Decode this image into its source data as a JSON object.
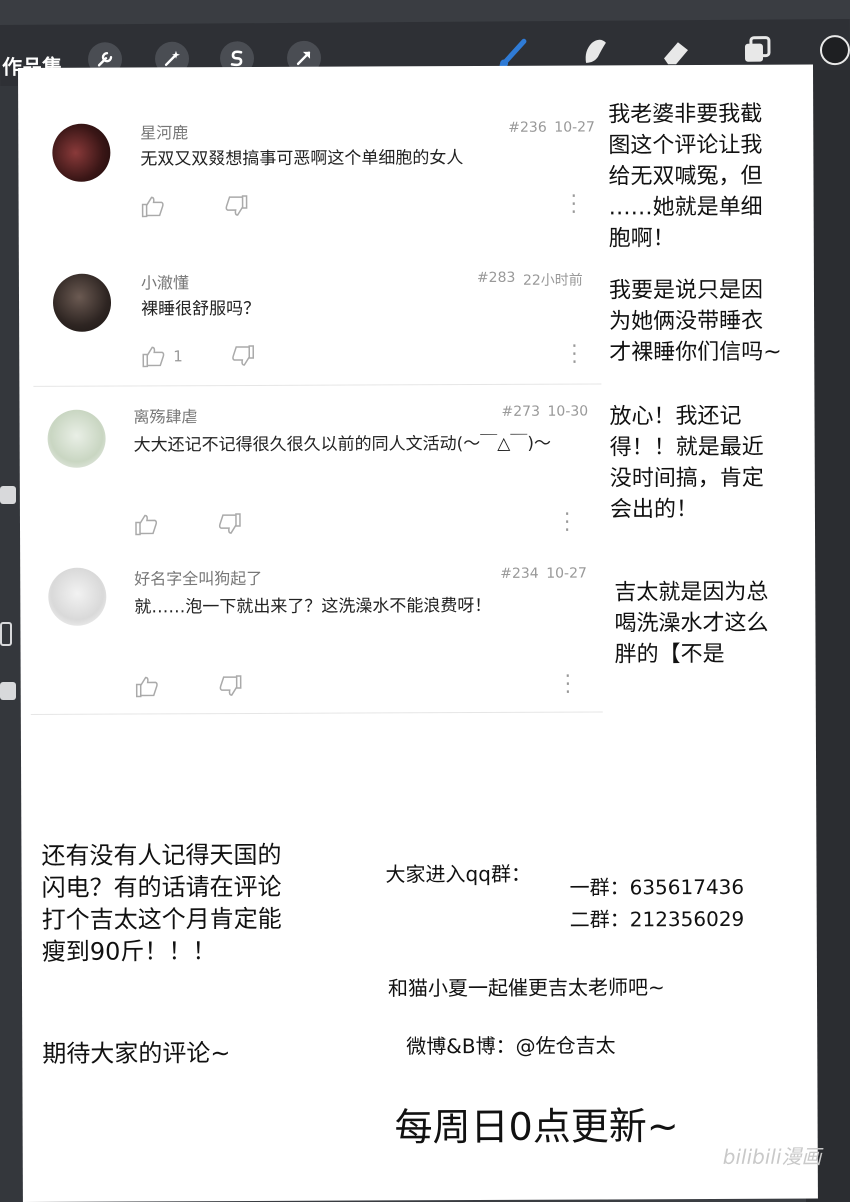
{
  "toolbar": {
    "title": "作品集",
    "tools": [
      "wrench-icon",
      "magic-wand-icon",
      "selection-s-icon",
      "transform-arrow-icon"
    ],
    "right_tools": [
      "brush-icon",
      "smudge-icon",
      "eraser-icon",
      "layers-icon",
      "color-circle-icon"
    ],
    "accent": "#2f7bd6"
  },
  "comments": [
    {
      "user": "星河鹿",
      "floor": "#236",
      "time": "10-27",
      "text": "无双又双叕想搞事可恶啊这个单细胞的女人",
      "likes": ""
    },
    {
      "user": "小澈懂",
      "floor": "#283",
      "time": "22小时前",
      "text": "裸睡很舒服吗？",
      "likes": "1"
    },
    {
      "user": "离殇肆虐",
      "floor": "#273",
      "time": "10-30",
      "text": "大大还记不记得很久很久以前的同人文活动(～￣△￣)～",
      "likes": ""
    },
    {
      "user": "好名字全叫狗起了",
      "floor": "#234",
      "time": "10-27",
      "text": "就……泡一下就出来了？这洗澡水不能浪费呀！",
      "likes": ""
    }
  ],
  "side_notes": [
    "我老婆非要我截\n图这个评论让我\n给无双喊冤，但\n……她就是单细\n胞啊！",
    "我要是说只是因\n为她俩没带睡衣\n才裸睡你们信吗~",
    "放心！我还记\n得！！就是最近\n没时间搞，肯定\n会出的！",
    "吉太就是因为总\n喝洗澡水才这么\n胖的【不是"
  ],
  "bottom": {
    "left_note": "还有没有人记得天国的\n闪电？有的话请在评论\n打个吉太这个月肯定能\n瘦到90斤！！！",
    "expect": "期待大家的评论~",
    "qq_label": "大家进入qq群：",
    "qq1": "一群：635617436",
    "qq2": "二群：212356029",
    "urge": "和猫小夏一起催更吉太老师吧~",
    "weibo": "微博&B博：@佐仓吉太",
    "update": "每周日0点更新~"
  },
  "watermark": "bilibili漫画"
}
